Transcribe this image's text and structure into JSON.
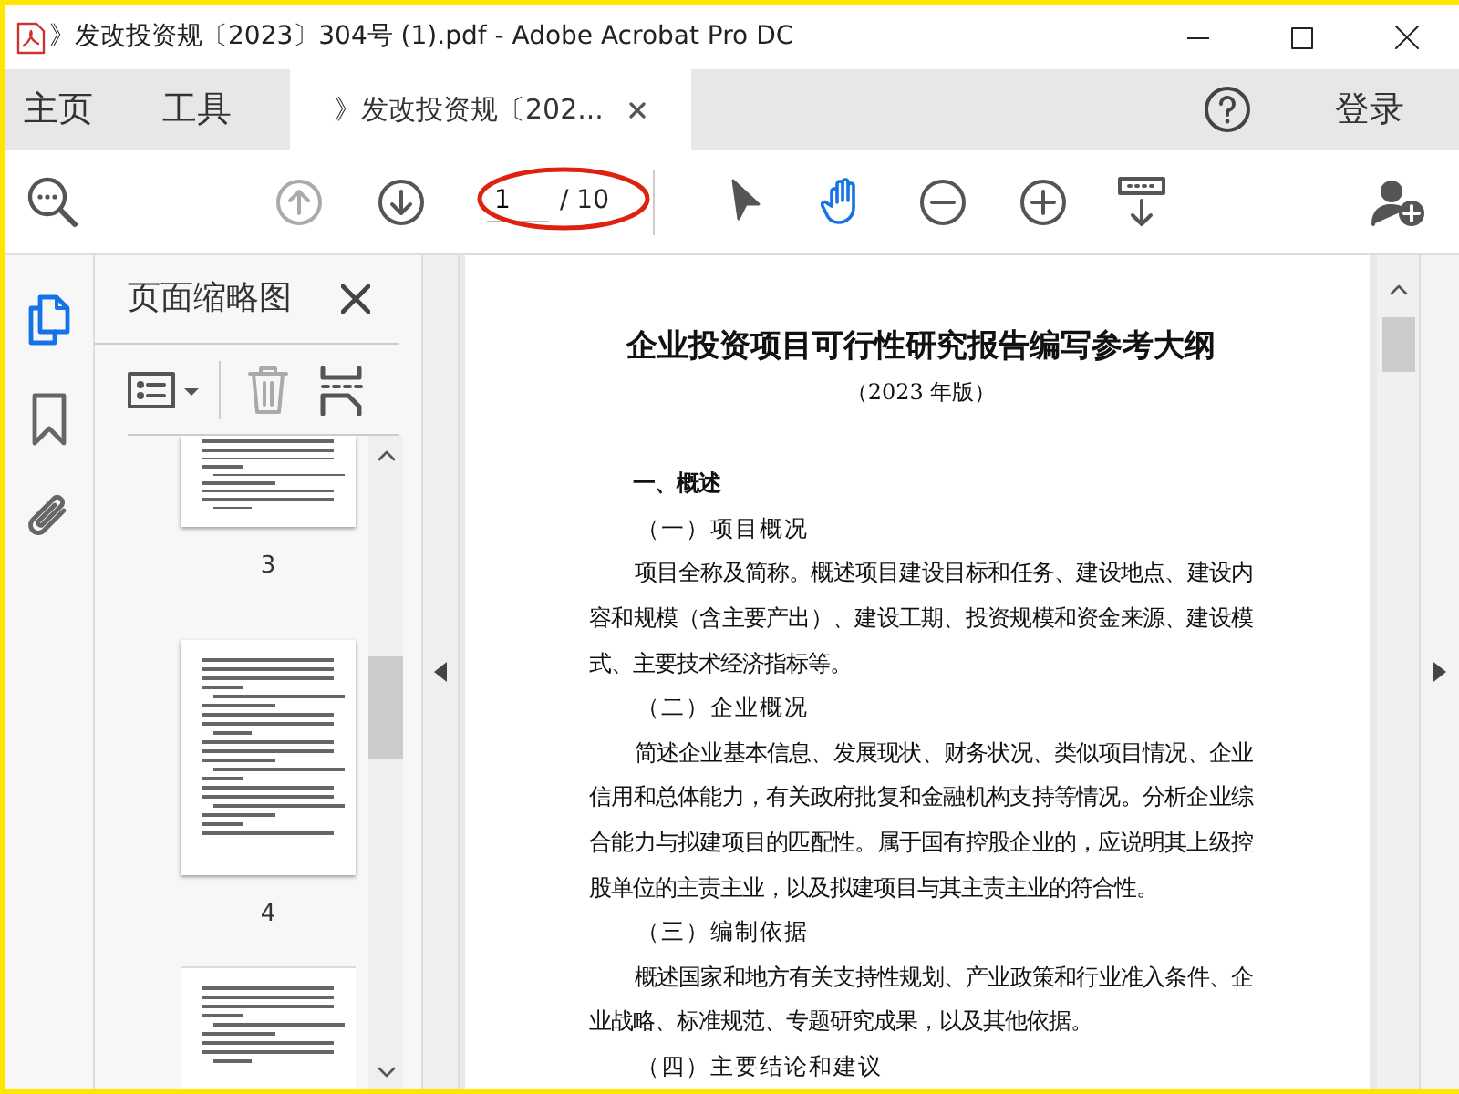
{
  "window": {
    "title": "》发改投资规〔2023〕304号 (1).pdf - Adobe Acrobat Pro DC"
  },
  "tabs": [
    {
      "label": "主页",
      "selected": false,
      "closable": false
    },
    {
      "label": "工具",
      "selected": false,
      "closable": false
    },
    {
      "label": "》发改投资规〔202...",
      "selected": true,
      "closable": true
    }
  ],
  "sign_in": "登录",
  "toolbar": {
    "prev_page": {
      "disabled": true
    },
    "next_page": {
      "disabled": false
    },
    "page_number": "1",
    "page_count": "/ 10",
    "select_tool": {
      "selected": false
    },
    "hand_tool": {
      "selected": true
    }
  },
  "side_rail": [
    {
      "kind": "pages",
      "selected": true
    },
    {
      "kind": "bookmarks",
      "selected": false
    },
    {
      "kind": "attachments",
      "selected": false
    }
  ],
  "thumbnail_panel": {
    "title": "页面缩略图",
    "delete_disabled": true,
    "thumbnails": [
      {
        "label": "3",
        "cut_top": true,
        "cut_bottom": false
      },
      {
        "label": "4",
        "cut_top": false,
        "cut_bottom": false
      },
      {
        "cut_top": false,
        "cut_bottom": true
      }
    ]
  },
  "document": {
    "title": "企业投资项目可行性研究报告编写参考大纲",
    "subtitle": "（2023 年版）",
    "blocks": [
      {
        "kind": "heading",
        "text": "一、概述"
      },
      {
        "kind": "subheading",
        "text": "（一）项目概况"
      },
      {
        "kind": "paragraph",
        "text": "项目全称及简称。概述项目建设目标和任务、建设地点、建设内容和规模（含主要产出）、建设工期、投资规模和资金来源、建设模式、主要技术经济指标等。"
      },
      {
        "kind": "subheading",
        "text": "（二）企业概况"
      },
      {
        "kind": "paragraph",
        "text": "简述企业基本信息、发展现状、财务状况、类似项目情况、企业信用和总体能力，有关政府批复和金融机构支持等情况。分析企业综合能力与拟建项目的匹配性。属于国有控股企业的，应说明其上级控股单位的主责主业，以及拟建项目与其主责主业的符合性。"
      },
      {
        "kind": "subheading",
        "text": "（三）编制依据"
      },
      {
        "kind": "paragraph",
        "text": "概述国家和地方有关支持性规划、产业政策和行业准入条件、企业战略、标准规范、专题研究成果，以及其他依据。"
      },
      {
        "kind": "subheading",
        "text": "（四）主要结论和建议"
      }
    ]
  }
}
